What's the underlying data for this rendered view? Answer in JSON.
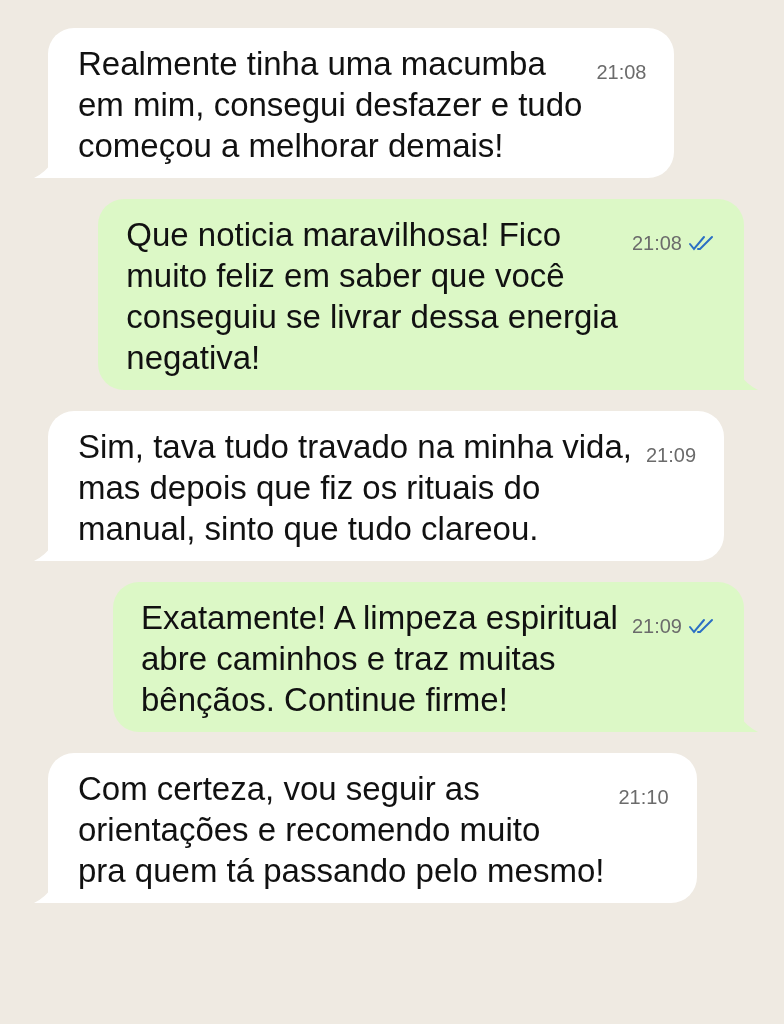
{
  "messages": [
    {
      "outgoing": false,
      "text": "Realmente tinha uma macumba\nem mim, consegui desfazer e tudo\ncomeçou a melhorar demais!",
      "time": "21:08"
    },
    {
      "outgoing": true,
      "text": "Que noticia maravilhosa! Fico\nmuito feliz em saber que você\nconseguiu se livrar dessa energia\nnegativa!",
      "time": "21:08",
      "read": true
    },
    {
      "outgoing": false,
      "text": "Sim, tava tudo travado na minha vida,\nmas depois que fiz os rituais do\nmanual, sinto que tudo clareou.",
      "time": "21:09"
    },
    {
      "outgoing": true,
      "text": "Exatamente! A limpeza espiritual\nabre caminhos e traz muitas\nbênçãos. Continue firme!",
      "time": "21:09",
      "read": true
    },
    {
      "outgoing": false,
      "text": "Com certeza, vou seguir as\norientações e recomendo muito\npra quem tá passando pelo mesmo!",
      "time": "21:10"
    }
  ]
}
